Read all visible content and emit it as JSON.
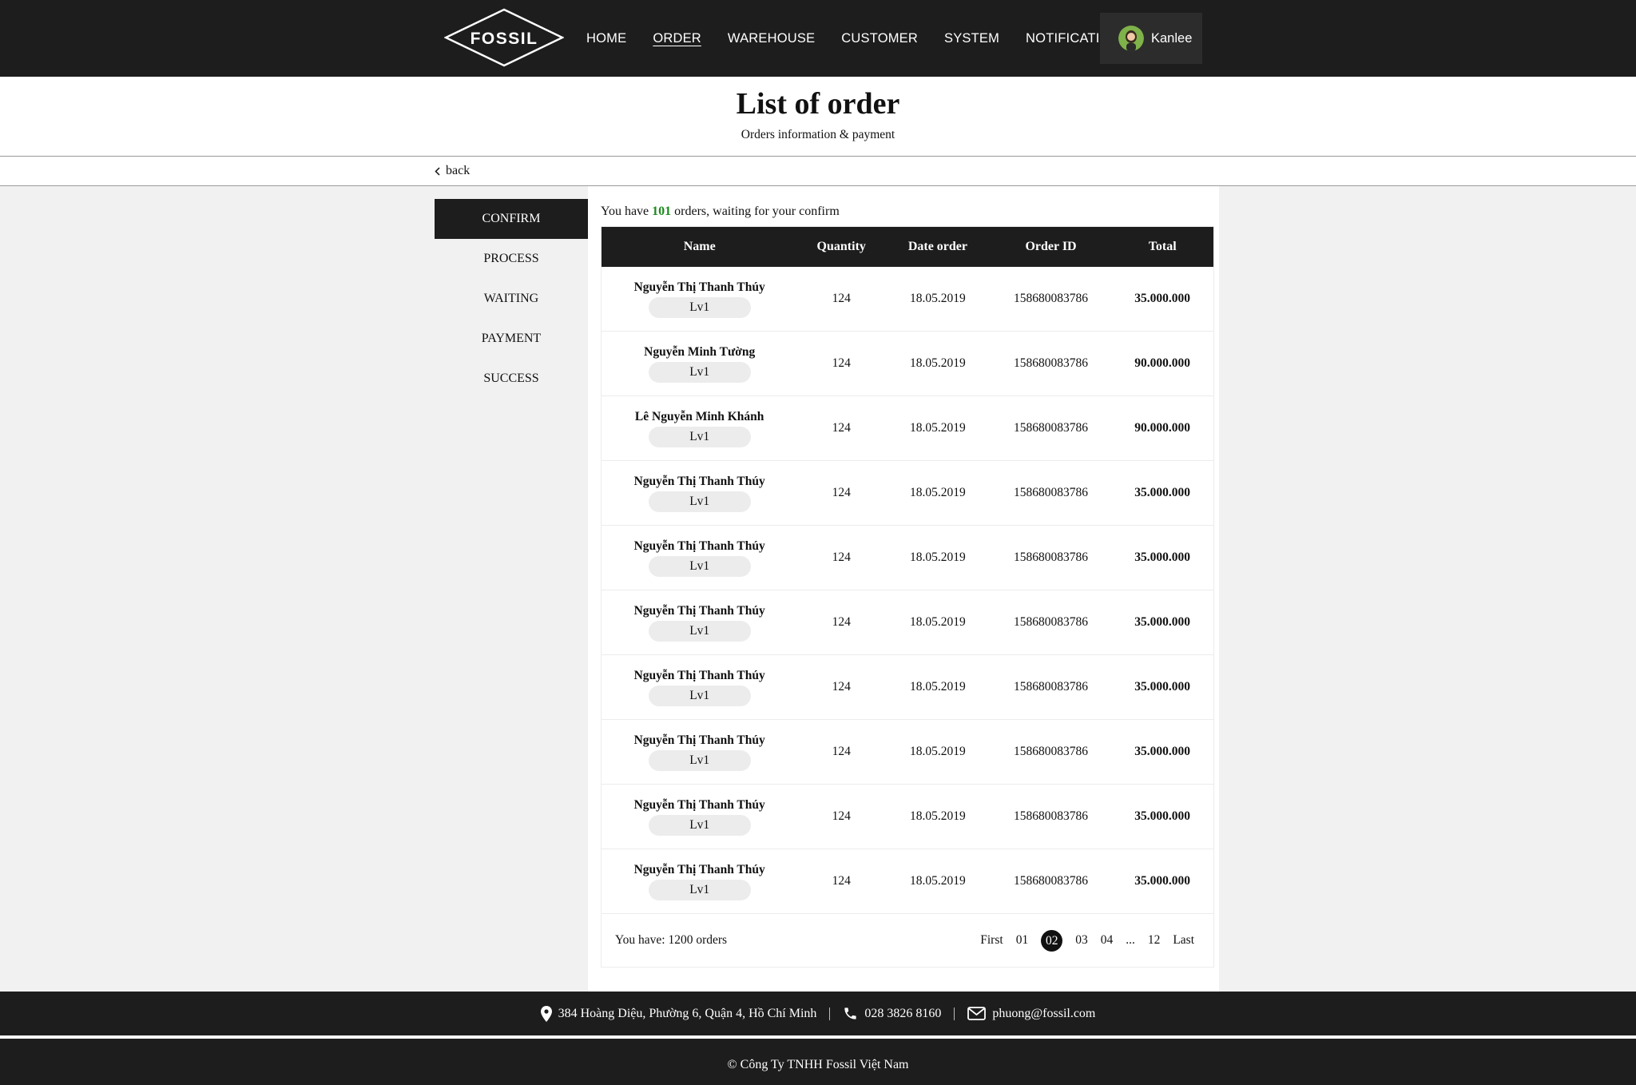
{
  "header": {
    "logo_text": "FOSSIL",
    "nav": [
      {
        "label": "HOME",
        "active": false
      },
      {
        "label": "ORDER",
        "active": true
      },
      {
        "label": "WAREHOUSE",
        "active": false
      },
      {
        "label": "CUSTOMER",
        "active": false
      },
      {
        "label": "SYSTEM",
        "active": false
      },
      {
        "label": "NOTIFICATION",
        "active": false
      }
    ],
    "user": {
      "name": "Kanlee",
      "avatar_icon": "user-avatar-icon"
    }
  },
  "page": {
    "title": "List of order",
    "subtitle": "Orders information & payment",
    "back_label": "back"
  },
  "sidebar": {
    "items": [
      {
        "label": "CONFIRM",
        "active": true
      },
      {
        "label": "PROCESS",
        "active": false
      },
      {
        "label": "WAITING",
        "active": false
      },
      {
        "label": "PAYMENT",
        "active": false
      },
      {
        "label": "SUCCESS",
        "active": false
      }
    ]
  },
  "summary": {
    "prefix": "You have ",
    "count": "101",
    "suffix": " orders, waiting for your confirm",
    "count_color": "#1a8a1a"
  },
  "table": {
    "columns": [
      "Name",
      "Quantity",
      "Date order",
      "Order ID",
      "Total"
    ],
    "rows": [
      {
        "name": "Nguyễn Thị Thanh Thúy",
        "level": "Lv1",
        "quantity": "124",
        "date": "18.05.2019",
        "order_id": "158680083786",
        "total": "35.000.000"
      },
      {
        "name": "Nguyễn Minh Tường",
        "level": "Lv1",
        "quantity": "124",
        "date": "18.05.2019",
        "order_id": "158680083786",
        "total": "90.000.000"
      },
      {
        "name": "Lê Nguyễn Minh Khánh",
        "level": "Lv1",
        "quantity": "124",
        "date": "18.05.2019",
        "order_id": "158680083786",
        "total": "90.000.000"
      },
      {
        "name": "Nguyễn Thị Thanh Thúy",
        "level": "Lv1",
        "quantity": "124",
        "date": "18.05.2019",
        "order_id": "158680083786",
        "total": "35.000.000"
      },
      {
        "name": "Nguyễn Thị Thanh Thúy",
        "level": "Lv1",
        "quantity": "124",
        "date": "18.05.2019",
        "order_id": "158680083786",
        "total": "35.000.000"
      },
      {
        "name": "Nguyễn Thị Thanh Thúy",
        "level": "Lv1",
        "quantity": "124",
        "date": "18.05.2019",
        "order_id": "158680083786",
        "total": "35.000.000"
      },
      {
        "name": "Nguyễn Thị Thanh Thúy",
        "level": "Lv1",
        "quantity": "124",
        "date": "18.05.2019",
        "order_id": "158680083786",
        "total": "35.000.000"
      },
      {
        "name": "Nguyễn Thị Thanh Thúy",
        "level": "Lv1",
        "quantity": "124",
        "date": "18.05.2019",
        "order_id": "158680083786",
        "total": "35.000.000"
      },
      {
        "name": "Nguyễn Thị Thanh Thúy",
        "level": "Lv1",
        "quantity": "124",
        "date": "18.05.2019",
        "order_id": "158680083786",
        "total": "35.000.000"
      },
      {
        "name": "Nguyễn Thị Thanh Thúy",
        "level": "Lv1",
        "quantity": "124",
        "date": "18.05.2019",
        "order_id": "158680083786",
        "total": "35.000.000"
      }
    ],
    "total_label": "You have: 1200 orders"
  },
  "pagination": {
    "items": [
      {
        "label": "First",
        "active": false
      },
      {
        "label": "01",
        "active": false
      },
      {
        "label": "02",
        "active": true
      },
      {
        "label": "03",
        "active": false
      },
      {
        "label": "04",
        "active": false
      },
      {
        "label": "...",
        "active": false
      },
      {
        "label": "12",
        "active": false
      },
      {
        "label": "Last",
        "active": false
      }
    ]
  },
  "footer": {
    "address": "384 Hoàng Diệu, Phường 6, Quận 4, Hồ Chí Minh",
    "phone": "028 3826 8160",
    "email": "phuong@fossil.com",
    "copyright": "© Công Ty TNHH Fossil Việt Nam",
    "icons": [
      "map-pin-icon",
      "phone-icon",
      "mail-icon"
    ]
  }
}
